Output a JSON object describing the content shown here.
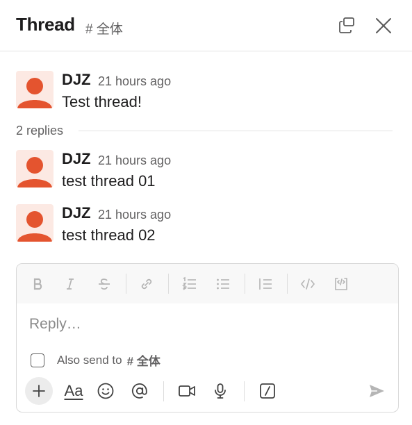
{
  "header": {
    "title": "Thread",
    "channel": "# 全体"
  },
  "thread": {
    "parent": {
      "author": "DJZ",
      "time": "21 hours ago",
      "text": "Test thread!"
    },
    "replies_label": "2 replies",
    "replies": [
      {
        "author": "DJZ",
        "time": "21 hours ago",
        "text": "test thread 01"
      },
      {
        "author": "DJZ",
        "time": "21 hours ago",
        "text": "test thread 02"
      }
    ]
  },
  "composer": {
    "placeholder": "Reply…",
    "also_send_label": "Also send to",
    "also_send_channel": "# 全体",
    "aa_label": "Aa"
  },
  "colors": {
    "avatar_bg": "#fce9e3",
    "avatar_fg": "#e4542f",
    "muted": "#616061"
  }
}
